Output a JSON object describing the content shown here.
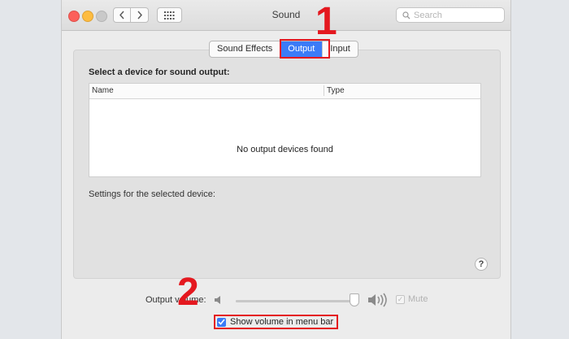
{
  "window": {
    "title": "Sound",
    "search_placeholder": "Search",
    "tabs": [
      {
        "label": "Sound Effects",
        "active": false
      },
      {
        "label": "Output",
        "active": true
      },
      {
        "label": "Input",
        "active": false
      }
    ]
  },
  "output": {
    "section_title": "Select a device for sound output:",
    "columns": [
      "Name",
      "Type"
    ],
    "empty_message": "No output devices found",
    "settings_label": "Settings for the selected device:",
    "help_label": "?"
  },
  "volume": {
    "label": "Output volume:",
    "level": 0.97,
    "mute_label": "Mute",
    "mute_checked": true,
    "show_in_menu_bar_label": "Show volume in menu bar",
    "show_in_menu_bar_checked": true
  },
  "annotations": {
    "step1": "1",
    "step2": "2",
    "highlight_color": "#e4181f"
  },
  "colors": {
    "accent": "#3b7bf7"
  },
  "icons": {
    "close": "close-dot-icon",
    "minimize": "minimize-dot-icon",
    "maximize": "maximize-dot-icon",
    "back": "chevron-left-icon",
    "forward": "chevron-right-icon",
    "grid": "grid-icon",
    "search": "search-icon",
    "speaker_low": "speaker-low-icon",
    "speaker_high": "speaker-high-icon",
    "help": "help-icon"
  }
}
